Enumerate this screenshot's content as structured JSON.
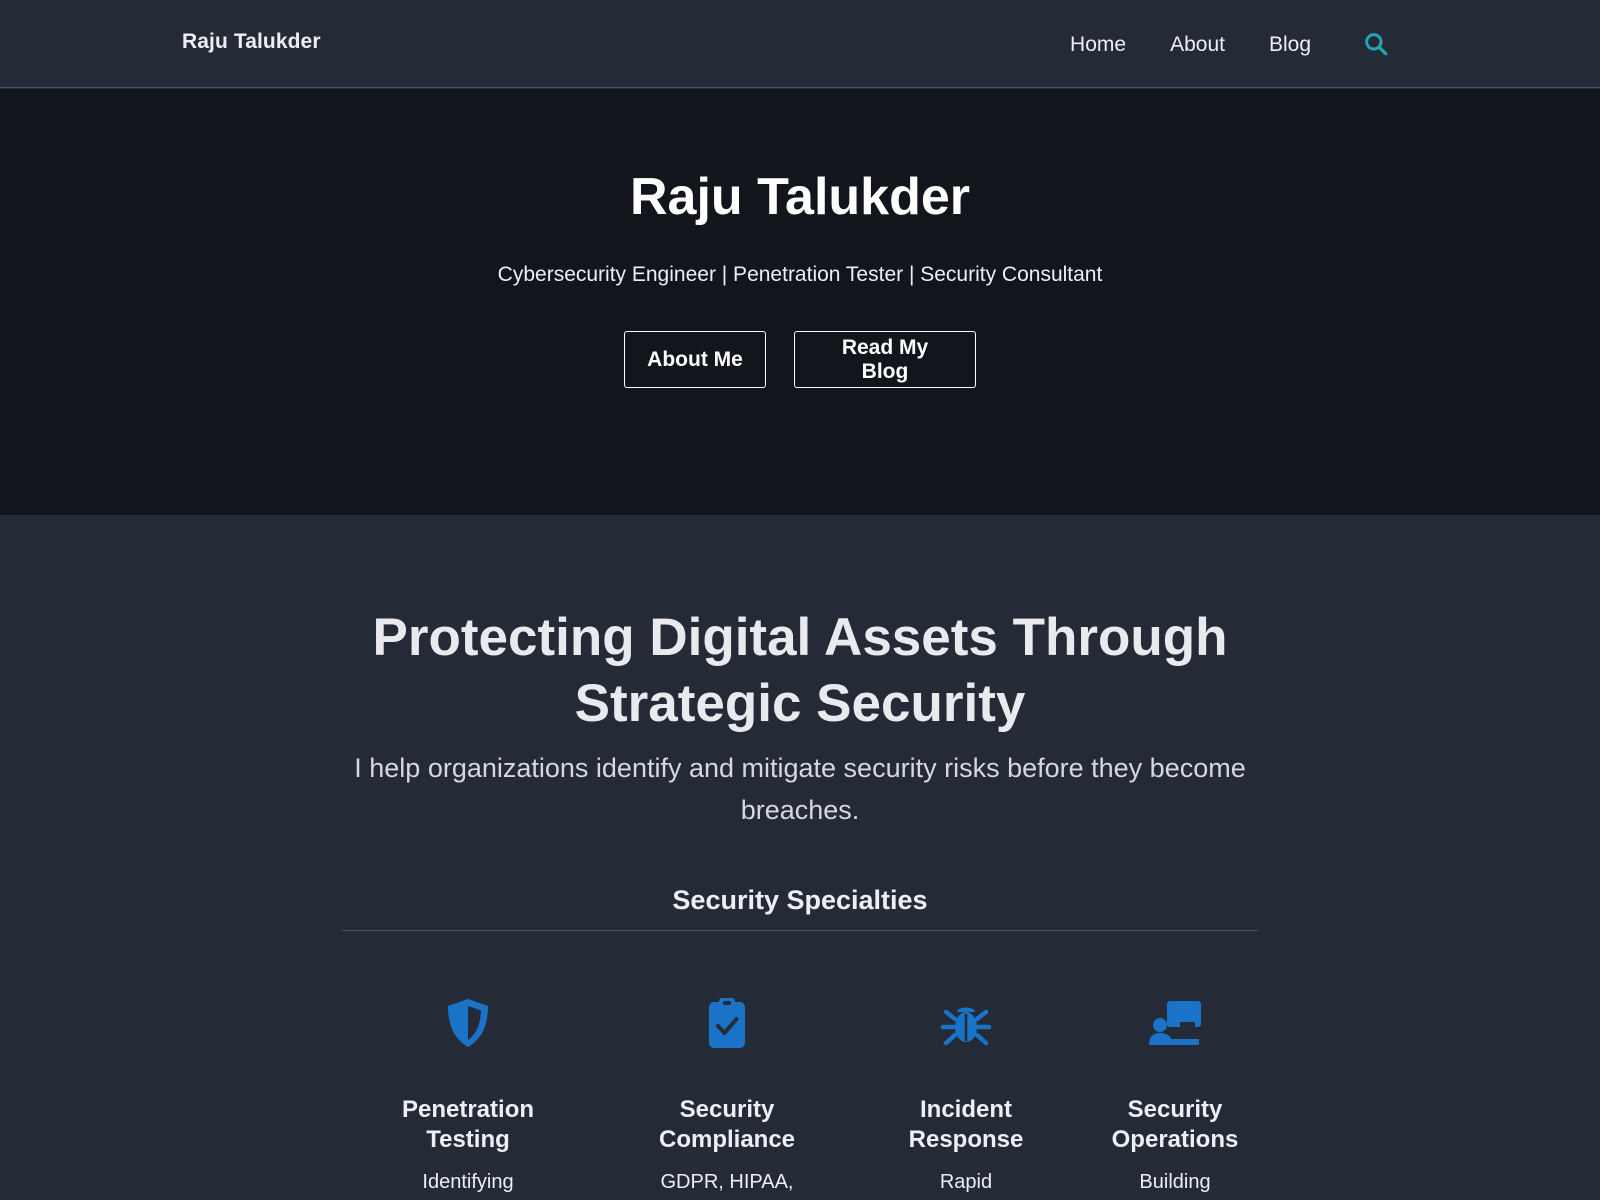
{
  "nav": {
    "brand": "Raju Talukder",
    "links": [
      {
        "label": "Home"
      },
      {
        "label": "About"
      },
      {
        "label": "Blog"
      }
    ],
    "search_icon": "search-icon"
  },
  "hero": {
    "title": "Raju Talukder",
    "subtitle": "Cybersecurity Engineer | Penetration Tester | Security Consultant",
    "buttons": {
      "about": "About Me",
      "blog": "Read My Blog"
    }
  },
  "main": {
    "headline_line1": "Protecting Digital Assets Through",
    "headline_line2": "Strategic Security",
    "lead_line1": "I help organizations identify and mitigate security risks before they become",
    "lead_line2": "breaches.",
    "specialties_title": "Security Specialties",
    "specialties": [
      {
        "icon": "shield-icon",
        "title_line1": "Penetration",
        "title_line2": "Testing",
        "desc": "Identifying"
      },
      {
        "icon": "clipboard-check-icon",
        "title_line1": "Security",
        "title_line2": "Compliance",
        "desc": "GDPR, HIPAA,"
      },
      {
        "icon": "bug-icon",
        "title_line1": "Incident",
        "title_line2": "Response",
        "desc": "Rapid"
      },
      {
        "icon": "chalkboard-user-icon",
        "title_line1": "Security",
        "title_line2": "Operations",
        "desc": "Building"
      }
    ]
  },
  "colors": {
    "nav_bg": "#252a37",
    "hero_bg": "#12151b",
    "page_bg": "#252a37",
    "accent_search": "#1fa6b0",
    "icon_blue": "#1a73c7"
  }
}
